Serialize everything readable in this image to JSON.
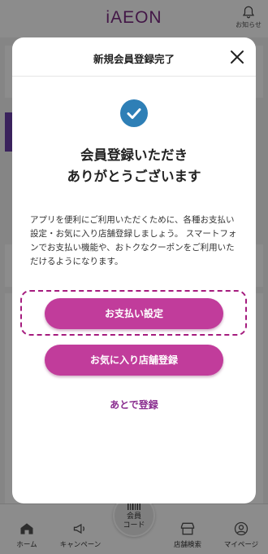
{
  "app": {
    "brand": "iAEON",
    "notification_label": "お知らせ"
  },
  "tabbar": {
    "items": [
      {
        "label": "ホーム",
        "icon": "home-icon"
      },
      {
        "label": "キャンペーン",
        "icon": "megaphone-icon"
      },
      {
        "label_line1": "会員",
        "label_line2": "コード",
        "icon": "barcode-icon"
      },
      {
        "label": "店舗検索",
        "icon": "store-icon"
      },
      {
        "label": "マイページ",
        "icon": "person-icon"
      }
    ]
  },
  "modal": {
    "title": "新規会員登録完了",
    "headline_line1": "会員登録いただき",
    "headline_line2": "ありがとうございます",
    "description": "アプリを便利にご利用いただくために、各種お支払い設定・お気に入り店舗登録しましょう。 スマートフォンでお支払い機能や、おトクなクーポンをご利用いただけるようになります。",
    "primary_button": "お支払い設定",
    "secondary_button": "お気に入り店舗登録",
    "later_link": "あとで登録"
  },
  "colors": {
    "accent": "#c13c9b",
    "highlight_outline": "#a51c7e",
    "check": "#2e7fb6"
  }
}
